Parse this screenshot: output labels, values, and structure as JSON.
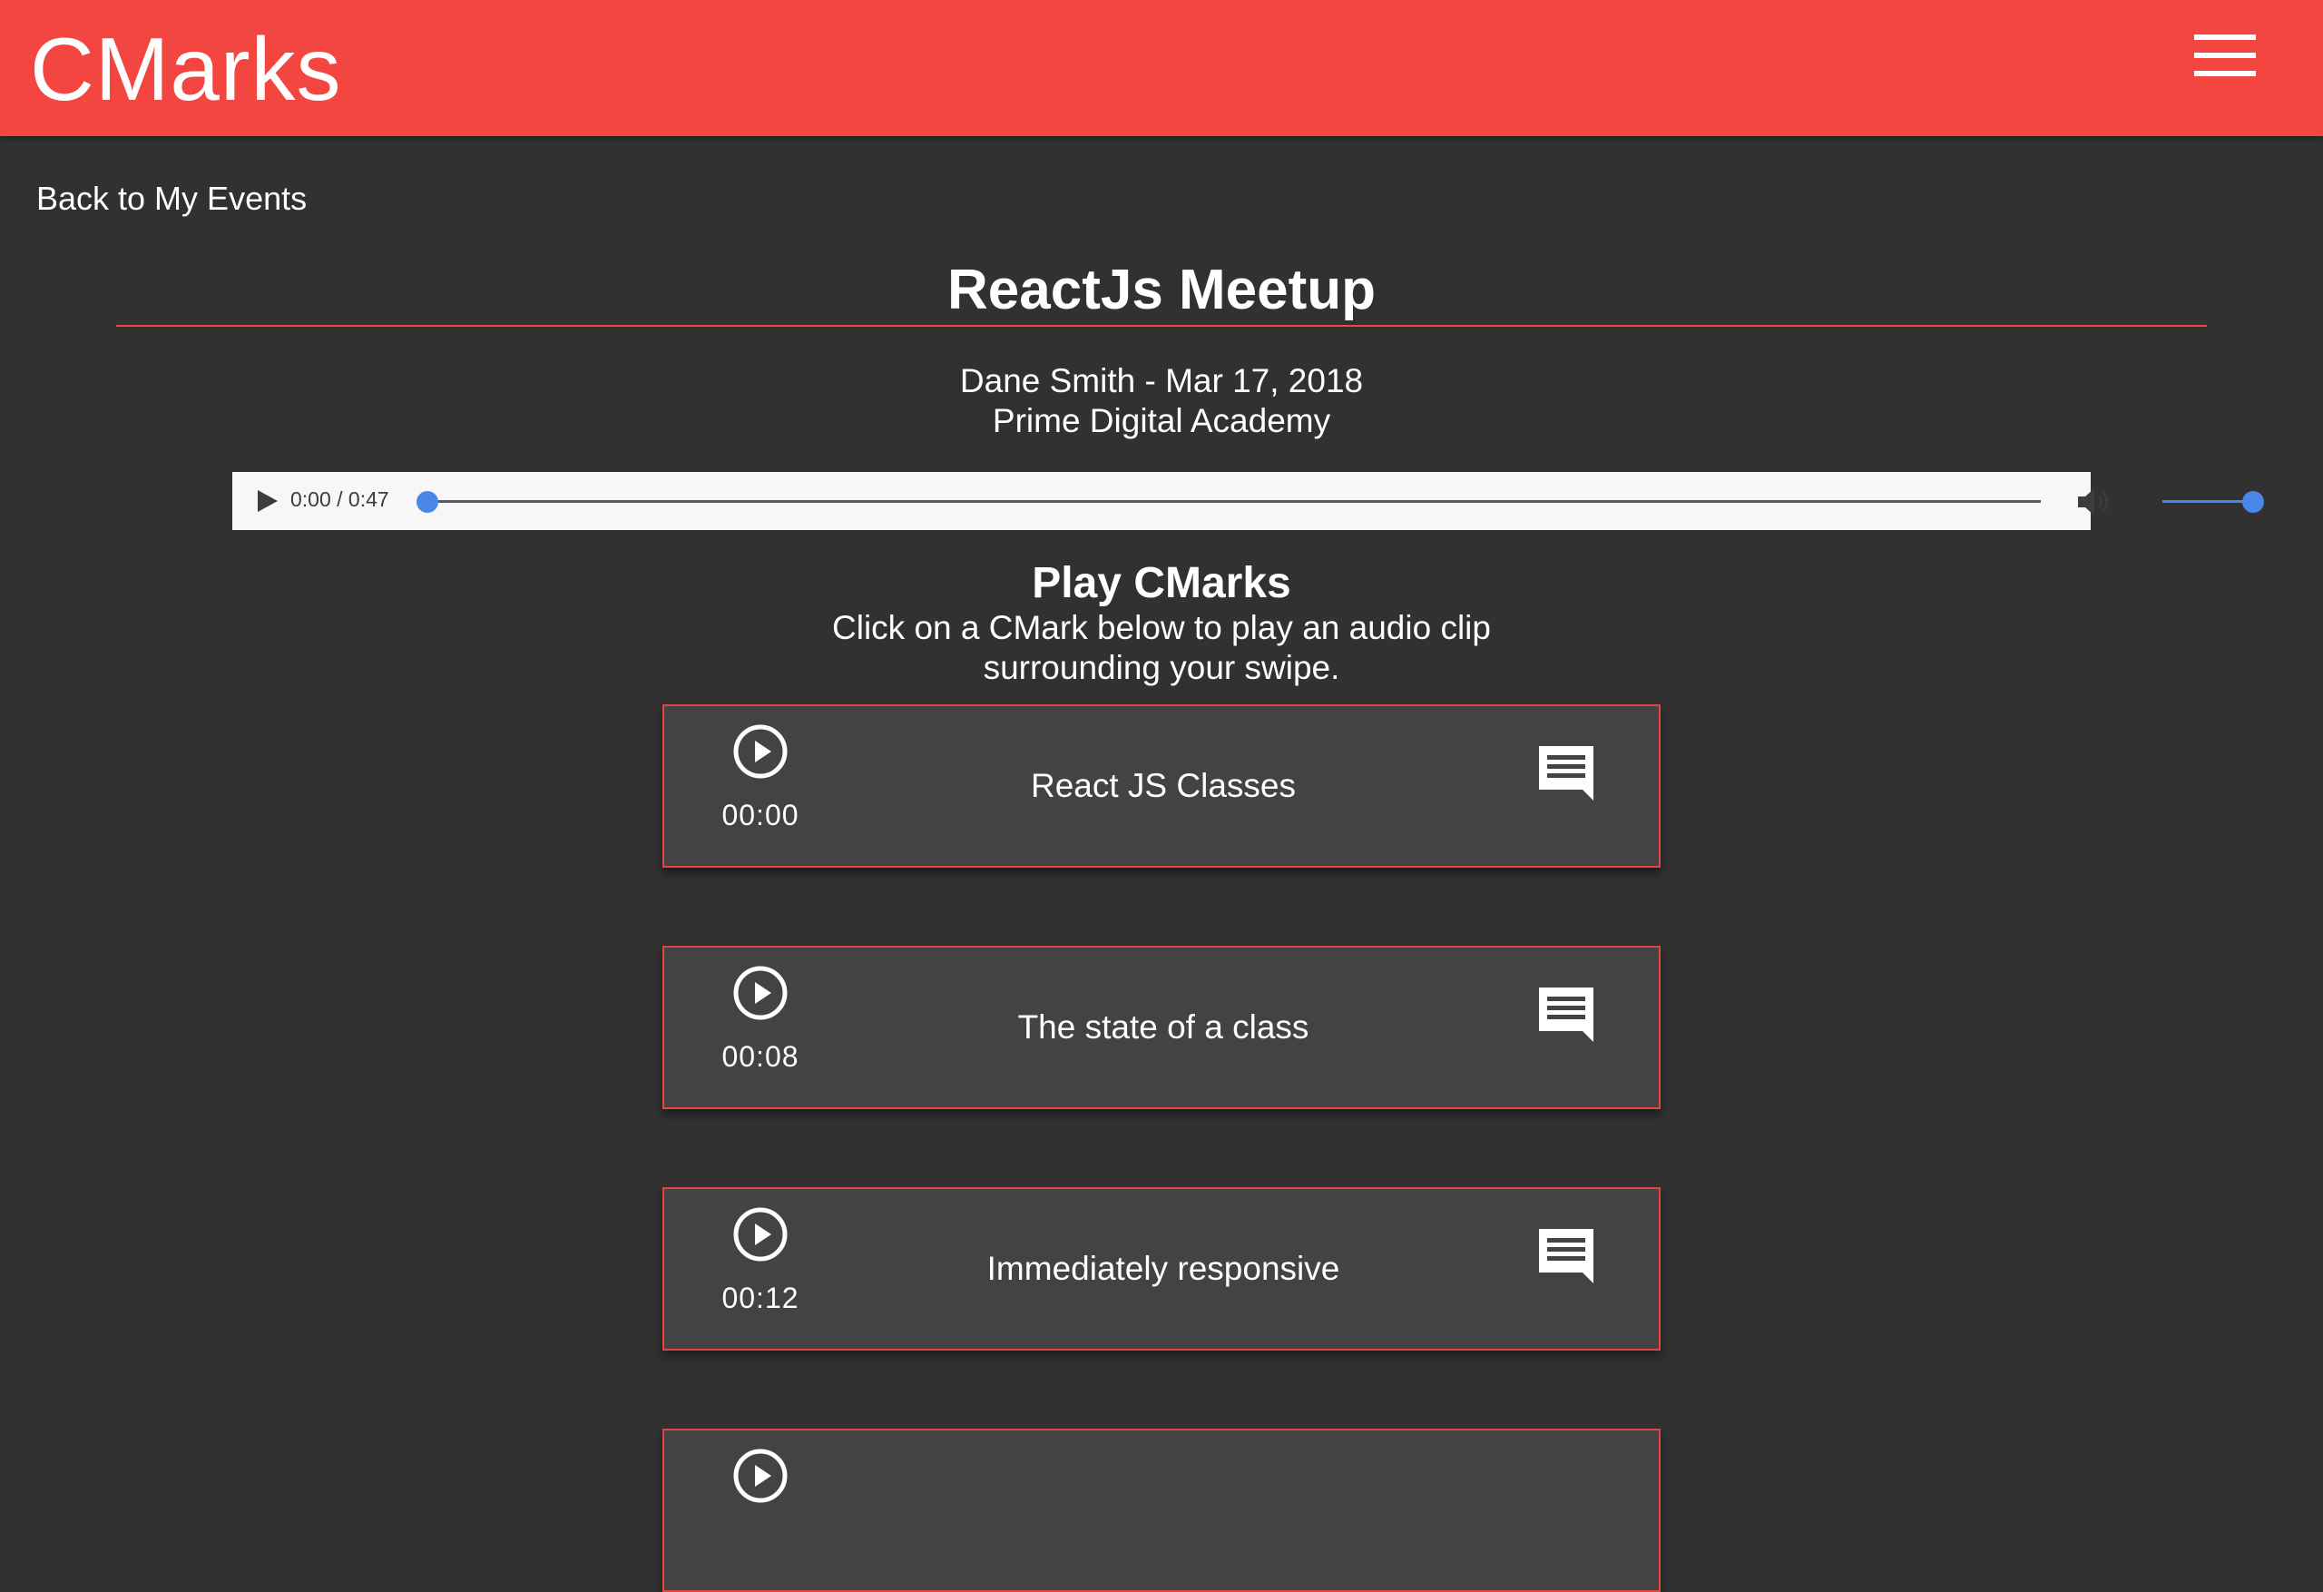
{
  "app": {
    "title": "CMarks",
    "accent": "#f44641",
    "background": "#313131",
    "card_bg": "#434343"
  },
  "header": {
    "menu_icon": "hamburger-menu-icon"
  },
  "nav": {
    "back_label": "Back to My Events"
  },
  "event": {
    "title": "ReactJs Meetup",
    "host_date": "Dane Smith - Mar 17, 2018",
    "location": "Prime Digital Academy"
  },
  "audio": {
    "time": "0:00 / 0:47",
    "progress": 0.0,
    "volume": 1.0,
    "play_icon": "play-icon",
    "volume_icon": "volume-icon"
  },
  "section": {
    "title": "Play CMarks",
    "subtitle_line1": "Click on a CMark below to play an audio clip",
    "subtitle_line2": "surrounding your swipe."
  },
  "cmarks": [
    {
      "time": "00:00",
      "label": "React JS Classes"
    },
    {
      "time": "00:08",
      "label": "The state of a class"
    },
    {
      "time": "00:12",
      "label": "Immediately responsive"
    },
    {
      "time": "",
      "label": ""
    }
  ]
}
